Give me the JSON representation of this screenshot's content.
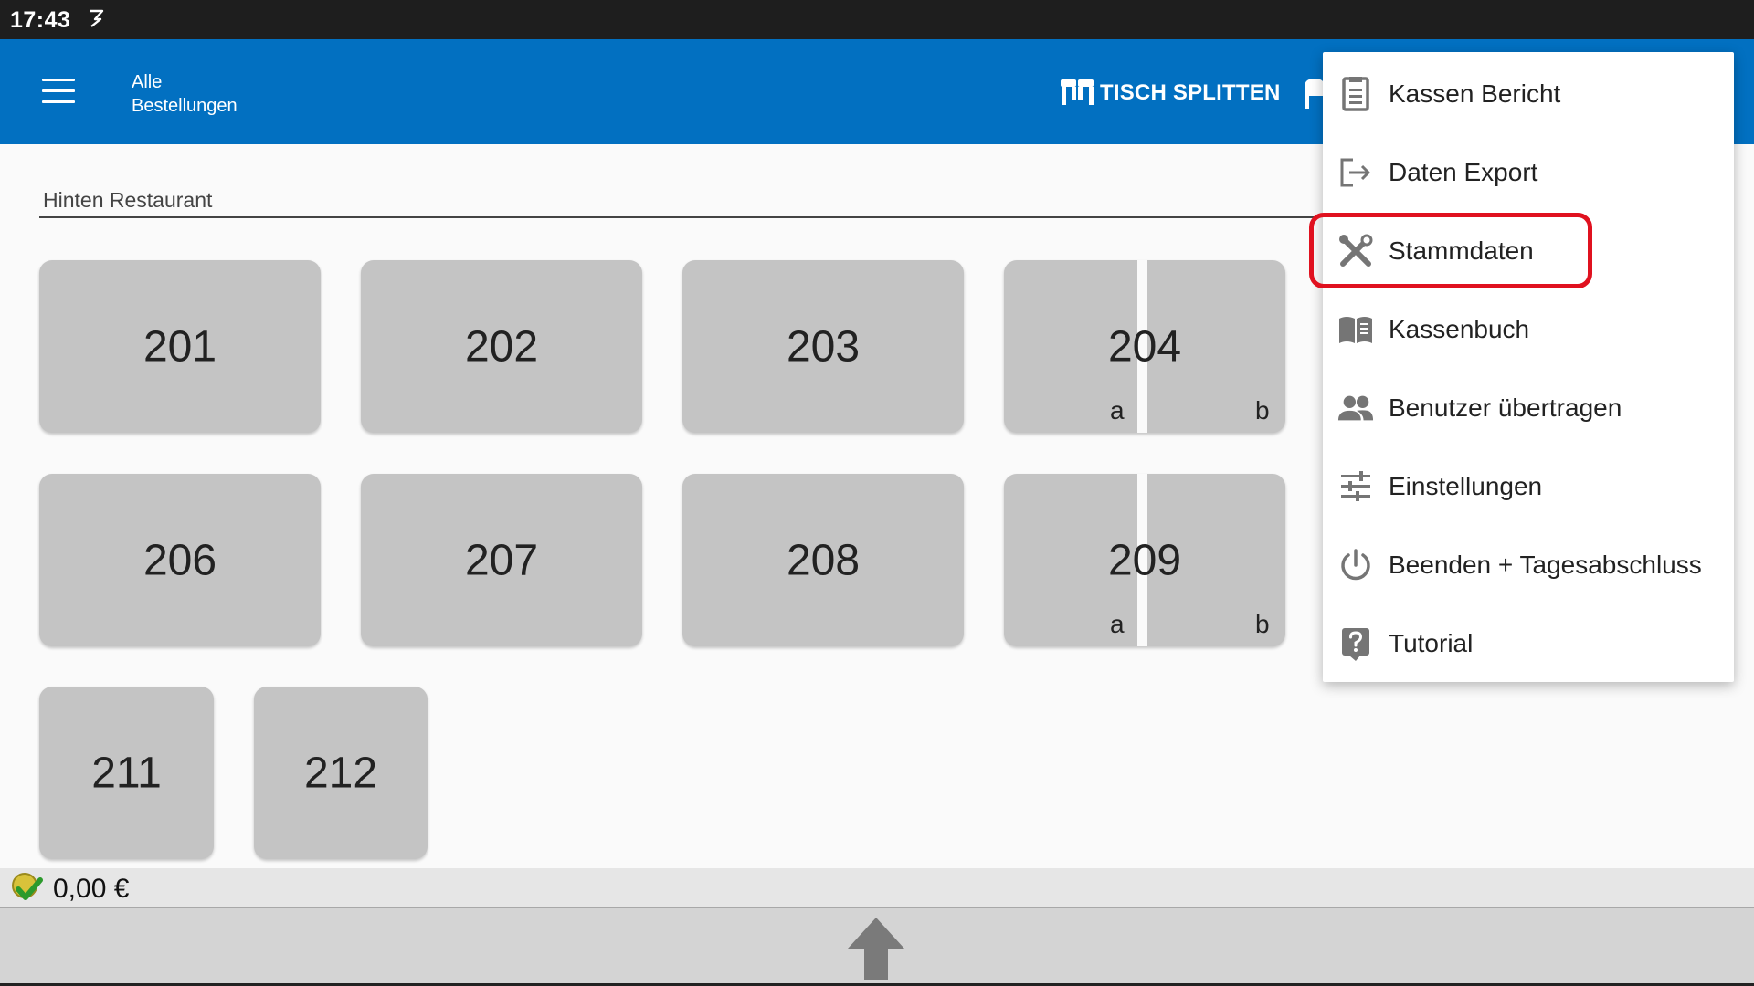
{
  "status_bar": {
    "time": "17:43"
  },
  "app_bar": {
    "title_line1": "Alle",
    "title_line2": "Bestellungen",
    "split_label": "TISCH SPLITTEN"
  },
  "area": {
    "name": "Hinten Restaurant"
  },
  "tables": [
    {
      "number": "201"
    },
    {
      "number": "202"
    },
    {
      "number": "203"
    },
    {
      "number": "204",
      "sub_a": "a",
      "sub_b": "b"
    },
    {
      "number": "206"
    },
    {
      "number": "207"
    },
    {
      "number": "208"
    },
    {
      "number": "209",
      "sub_a": "a",
      "sub_b": "b"
    },
    {
      "number": "211"
    },
    {
      "number": "212"
    }
  ],
  "footer": {
    "total": "0,00 €"
  },
  "menu": {
    "items": [
      {
        "label": "Kassen Bericht",
        "icon": "report-icon"
      },
      {
        "label": "Daten Export",
        "icon": "export-icon"
      },
      {
        "label": "Stammdaten",
        "icon": "tools-icon",
        "highlighted": true
      },
      {
        "label": "Kassenbuch",
        "icon": "book-icon"
      },
      {
        "label": "Benutzer übertragen",
        "icon": "users-icon"
      },
      {
        "label": "Einstellungen",
        "icon": "sliders-icon"
      },
      {
        "label": "Beenden + Tagesabschluss",
        "icon": "power-icon"
      },
      {
        "label": "Tutorial",
        "icon": "help-icon"
      }
    ]
  },
  "colors": {
    "app_bar": "#0270c1",
    "tile": "#c4c4c4",
    "highlight": "#e0111f",
    "menu_icon": "#757575"
  }
}
